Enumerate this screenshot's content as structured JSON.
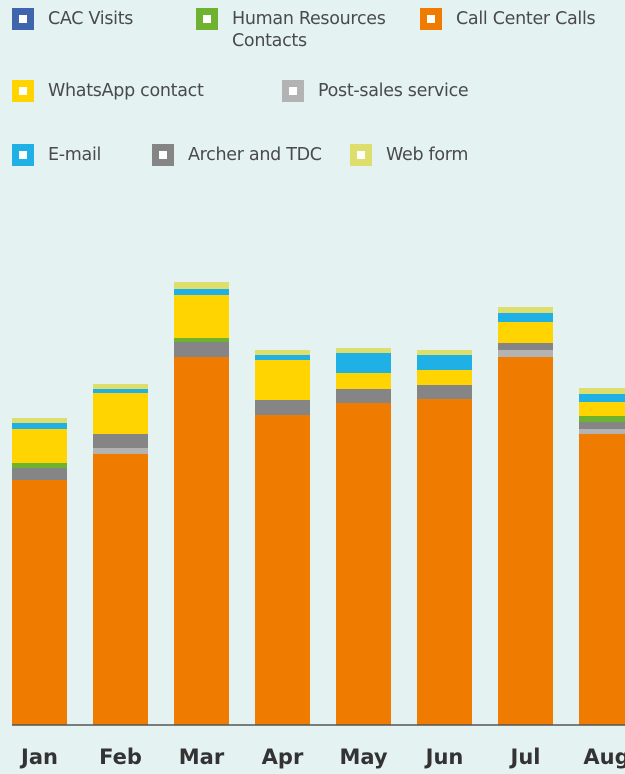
{
  "chart_data": {
    "type": "bar",
    "stacked": true,
    "categories": [
      "Jan",
      "Feb",
      "Mar",
      "Apr",
      "May",
      "Jun",
      "Jul",
      "Aug"
    ],
    "series": [
      {
        "name": "CAC Visits",
        "color": "#3f66ad",
        "values": [
          0,
          0,
          0,
          0,
          0,
          0,
          0,
          0
        ]
      },
      {
        "name": "Human Resources Contacts",
        "color": "#6fb230",
        "values": [
          5,
          0,
          4,
          0,
          0,
          0,
          0,
          6
        ]
      },
      {
        "name": "Call Center Calls",
        "color": "#ef7b00",
        "values": [
          245,
          271,
          368,
          310,
          322,
          326,
          368,
          291
        ]
      },
      {
        "name": "WhatsApp contact",
        "color": "#ffd400",
        "values": [
          34,
          41,
          43,
          40,
          16,
          15,
          21,
          14
        ]
      },
      {
        "name": "Post-sales service",
        "color": "#b3b3b3",
        "values": [
          0,
          6,
          0,
          0,
          0,
          0,
          7,
          5
        ]
      },
      {
        "name": "E-mail",
        "color": "#1fb1e6",
        "values": [
          6,
          4,
          6,
          5,
          20,
          15,
          9,
          8
        ]
      },
      {
        "name": "Archer and TDC",
        "color": "#858585",
        "values": [
          12,
          14,
          15,
          15,
          14,
          14,
          7,
          7
        ]
      },
      {
        "name": "Web form",
        "color": "#dede6c",
        "values": [
          5,
          5,
          7,
          5,
          5,
          5,
          6,
          6
        ]
      }
    ],
    "stack_order": [
      "Call Center Calls",
      "Post-sales service",
      "Archer and TDC",
      "Human Resources Contacts",
      "CAC Visits",
      "WhatsApp contact",
      "E-mail",
      "Web form"
    ],
    "legend_position": "top",
    "grid": false
  },
  "legend": {
    "cac": "CAC Visits",
    "hr_line1": "Human Resources",
    "hr_line2": "Contacts",
    "calls": "Call Center Calls",
    "whatsapp": "WhatsApp contact",
    "postsales": "Post-sales service",
    "email": "E-mail",
    "archer": "Archer and TDC",
    "webform": "Web form"
  },
  "colors": {
    "background": "#e4f3f2",
    "axis": "#555555"
  }
}
